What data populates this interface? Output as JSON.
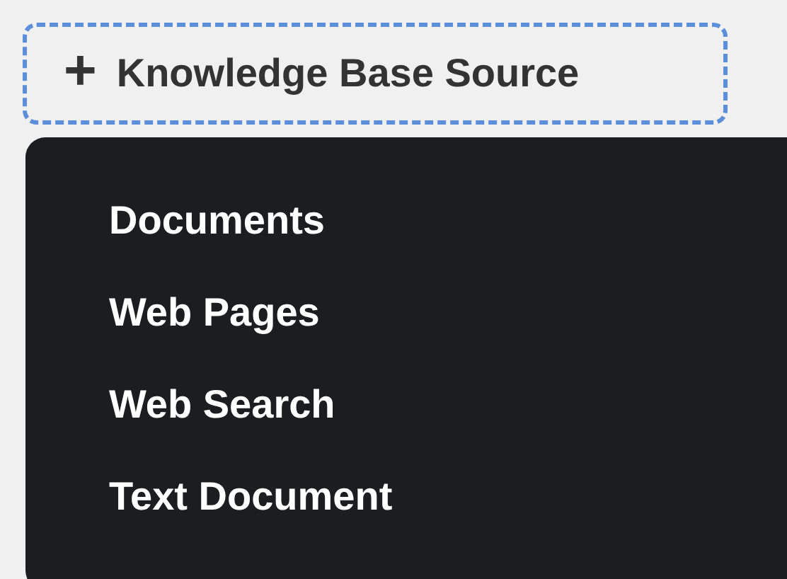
{
  "add_button": {
    "icon": "+",
    "label": "Knowledge Base Source"
  },
  "menu": {
    "items": [
      {
        "label": "Documents"
      },
      {
        "label": "Web Pages"
      },
      {
        "label": "Web Search"
      },
      {
        "label": "Text Document"
      }
    ]
  }
}
